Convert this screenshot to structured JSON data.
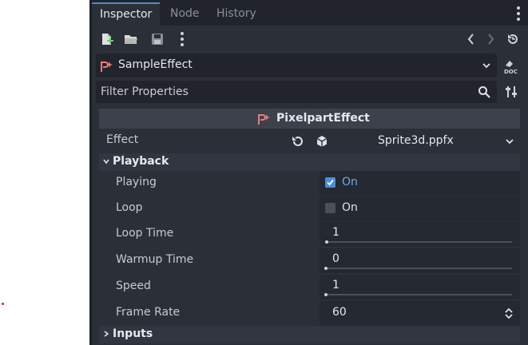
{
  "tabs": [
    {
      "label": "Inspector",
      "active": true
    },
    {
      "label": "Node",
      "active": false
    },
    {
      "label": "History",
      "active": false
    }
  ],
  "object": {
    "name": "SampleEffect"
  },
  "filter": {
    "placeholder": "Filter Properties"
  },
  "header": {
    "title": "PixelpartEffect"
  },
  "effect": {
    "label": "Effect",
    "value": "Sprite3d.ppfx"
  },
  "playback": {
    "section_label": "Playback",
    "playing": {
      "label": "Playing",
      "checked": true,
      "text": "On"
    },
    "loop": {
      "label": "Loop",
      "checked": false,
      "text": "On"
    },
    "loop_time": {
      "label": "Loop Time",
      "value": "1"
    },
    "warmup_time": {
      "label": "Warmup Time",
      "value": "0"
    },
    "speed": {
      "label": "Speed",
      "value": "1"
    },
    "frame_rate": {
      "label": "Frame Rate",
      "value": "60"
    }
  },
  "inputs": {
    "section_label": "Inputs"
  },
  "colors": {
    "accent": "#4a8fd8",
    "panel": "#2b2f38",
    "field": "#21252b",
    "icon_red": "#f07a7a"
  },
  "icons": [
    "new-resource-icon",
    "open-folder-icon",
    "save-icon",
    "kebab-menu-icon",
    "history-back-icon",
    "history-forward-icon",
    "object-history-icon",
    "doc-icon",
    "search-icon",
    "filter-options-icon",
    "reset-icon",
    "resource-cube-icon"
  ]
}
